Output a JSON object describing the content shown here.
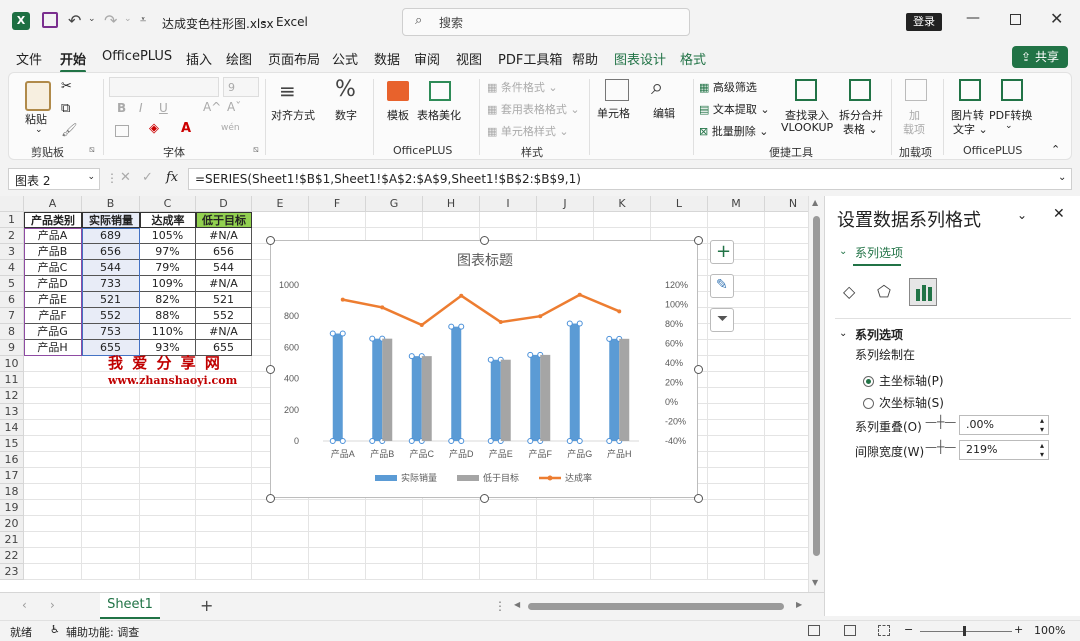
{
  "app": {
    "autosave": "⊟",
    "filename": "达成变色柱形图.xlsx",
    "separator": "-",
    "app_name": "Excel",
    "search_placeholder": "搜索",
    "login": "登录"
  },
  "menu": [
    "文件",
    "开始",
    "OfficePLUS",
    "插入",
    "绘图",
    "页面布局",
    "公式",
    "数据",
    "审阅",
    "视图",
    "PDF工具箱",
    "帮助",
    "图表设计",
    "格式"
  ],
  "share": "共享",
  "ribbon": {
    "paste": "粘贴",
    "clipboard": "剪贴板",
    "font_size": "9",
    "font_group": "字体",
    "bold": "B",
    "italic": "I",
    "underline": "U",
    "align": "对齐方式",
    "number": "数字",
    "template": "模板",
    "table_beautify": "表格美化",
    "officeplus1": "OfficePLUS",
    "cond_format": "条件格式",
    "table_format": "套用表格格式",
    "cell_style": "单元格样式",
    "style_group": "样式",
    "cells": "单元格",
    "edit": "编辑",
    "adv_filter": "高级筛选",
    "text_extract": "文本提取",
    "batch_delete": "批量删除",
    "find_entry": "查找录入",
    "vlookup": "VLOOKUP",
    "split_merge": "拆分合并",
    "table_label": "表格",
    "convenient_tools": "便捷工具",
    "add": "加",
    "add_item": "载项",
    "addins_group": "加载项",
    "img_to_text": "图片转",
    "text_label": "文字",
    "pdf_convert": "PDF转换",
    "officeplus2": "OfficePLUS"
  },
  "formula_bar": {
    "name_box": "图表 2",
    "fx": "fx",
    "formula": "=SERIES(Sheet1!$B$1,Sheet1!$A$2:$A$9,Sheet1!$B$2:$B$9,1)"
  },
  "grid": {
    "columns": [
      "A",
      "B",
      "C",
      "D",
      "E",
      "F",
      "G",
      "H",
      "I",
      "J",
      "K",
      "L",
      "M",
      "N"
    ],
    "rows": [
      "1",
      "2",
      "3",
      "4",
      "5",
      "6",
      "7",
      "8",
      "9",
      "10",
      "11",
      "12",
      "13",
      "14",
      "15",
      "16",
      "17",
      "18",
      "19",
      "20",
      "21",
      "22",
      "23"
    ],
    "header": [
      "产品类别",
      "实际销量",
      "达成率",
      "低于目标"
    ],
    "data": [
      [
        "产品A",
        "689",
        "105%",
        "#N/A"
      ],
      [
        "产品B",
        "656",
        "97%",
        "656"
      ],
      [
        "产品C",
        "544",
        "79%",
        "544"
      ],
      [
        "产品D",
        "733",
        "109%",
        "#N/A"
      ],
      [
        "产品E",
        "521",
        "82%",
        "521"
      ],
      [
        "产品F",
        "552",
        "88%",
        "552"
      ],
      [
        "产品G",
        "753",
        "110%",
        "#N/A"
      ],
      [
        "产品H",
        "655",
        "93%",
        "655"
      ]
    ],
    "watermark_title": "我 爱 分 享 网",
    "watermark_url": "www.zhanshaoyi.com"
  },
  "chart_data": {
    "type": "bar",
    "title": "图表标题",
    "categories": [
      "产品A",
      "产品B",
      "产品C",
      "产品D",
      "产品E",
      "产品F",
      "产品G",
      "产品H"
    ],
    "series": [
      {
        "name": "实际销量",
        "type": "bar",
        "axis": "primary",
        "color": "#5b9bd5",
        "values": [
          689,
          656,
          544,
          733,
          521,
          552,
          753,
          655
        ]
      },
      {
        "name": "低于目标",
        "type": "bar",
        "axis": "primary",
        "color": "#a5a5a5",
        "values": [
          null,
          656,
          544,
          null,
          521,
          552,
          null,
          655
        ]
      },
      {
        "name": "达成率",
        "type": "line",
        "axis": "secondary",
        "color": "#ed7d31",
        "values": [
          1.05,
          0.97,
          0.79,
          1.09,
          0.82,
          0.88,
          1.1,
          0.93
        ]
      }
    ],
    "ylim": [
      0,
      1000
    ],
    "yticks": [
      "0",
      "200",
      "400",
      "600",
      "800",
      "1000"
    ],
    "y2lim": [
      -0.4,
      1.2
    ],
    "y2ticks": [
      "-40%",
      "-20%",
      "0%",
      "20%",
      "40%",
      "60%",
      "80%",
      "100%",
      "120%"
    ],
    "legend": "bottom",
    "grid": false
  },
  "pane": {
    "title": "设置数据系列格式",
    "tab": "系列选项",
    "section": "系列选项",
    "plot_on": "系列绘制在",
    "primary_axis": "主坐标轴(P)",
    "secondary_axis": "次坐标轴(S)",
    "overlap_label": "系列重叠(O)",
    "overlap_value": ".00%",
    "gap_label": "间隙宽度(W)",
    "gap_value": "219%"
  },
  "sheet_tab": "Sheet1",
  "status": {
    "ready": "就绪",
    "accessibility": "辅助功能: 调查",
    "zoom": "100%"
  },
  "colors": {
    "accent": "#217346",
    "header_fill_b": "#e8ecf7",
    "header_green": "#92d050",
    "watermark": "#c00000"
  }
}
